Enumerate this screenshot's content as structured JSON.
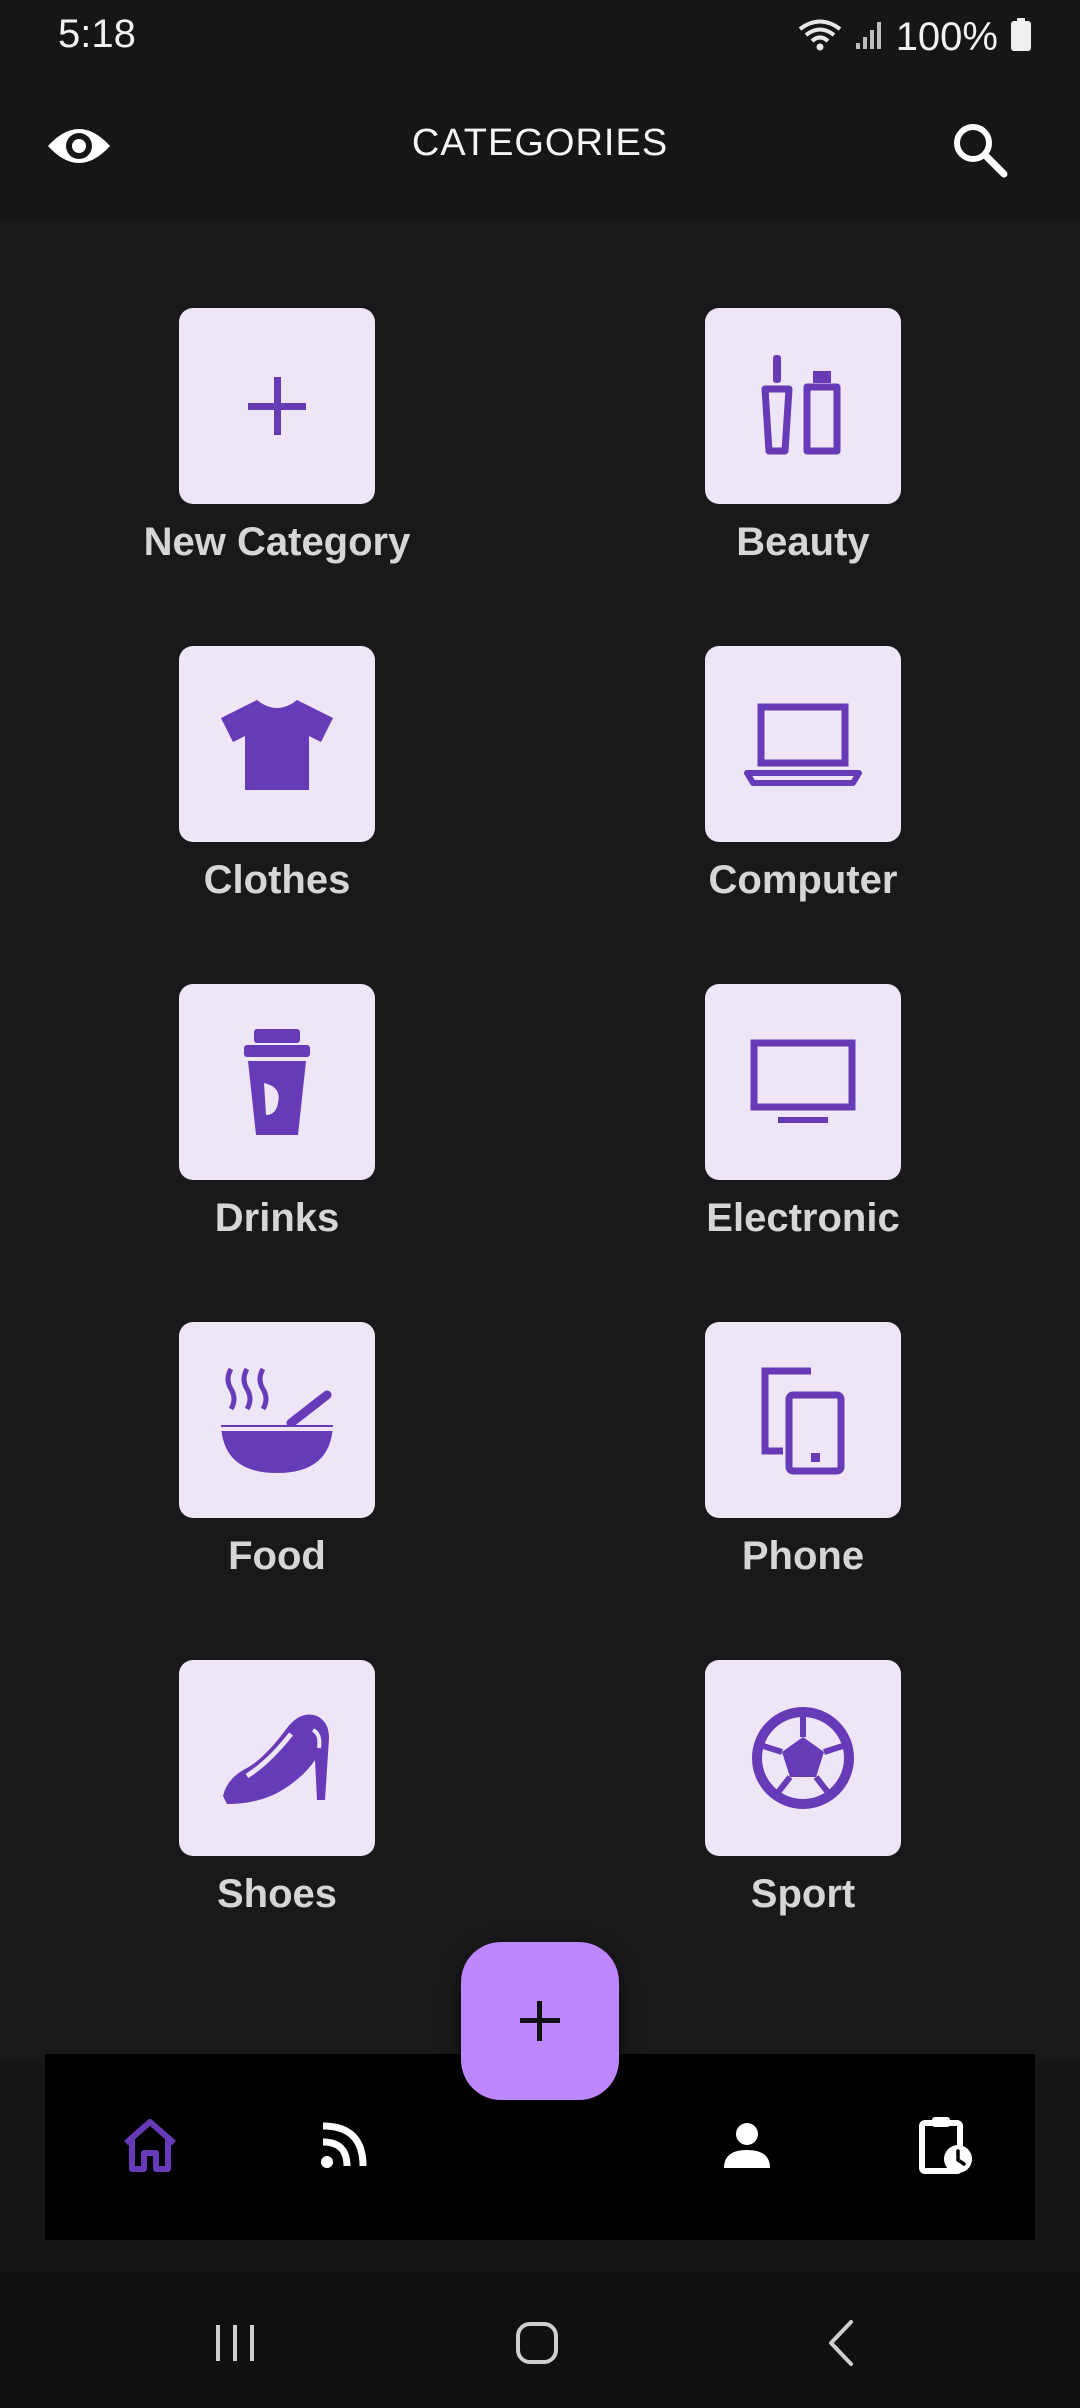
{
  "status_bar": {
    "time": "5:18",
    "battery_percent": "100%",
    "icons": [
      "wifi-icon",
      "signal-icon",
      "battery-icon"
    ]
  },
  "app_bar": {
    "title": "CATEGORIES",
    "left_icon": "eye-icon",
    "right_icon": "search-icon"
  },
  "categories": [
    {
      "label": "New Category",
      "icon": "plus-icon"
    },
    {
      "label": "Beauty",
      "icon": "beauty-icon"
    },
    {
      "label": "Clothes",
      "icon": "tshirt-icon"
    },
    {
      "label": "Computer",
      "icon": "laptop-icon"
    },
    {
      "label": "Drinks",
      "icon": "cup-icon"
    },
    {
      "label": "Electronic",
      "icon": "monitor-icon"
    },
    {
      "label": "Food",
      "icon": "bowl-icon"
    },
    {
      "label": "Phone",
      "icon": "devices-icon"
    },
    {
      "label": "Shoes",
      "icon": "heel-icon"
    },
    {
      "label": "Sport",
      "icon": "soccer-ball-icon"
    }
  ],
  "fab": {
    "icon": "plus-icon"
  },
  "bottom_nav": {
    "items": [
      {
        "name": "home",
        "icon": "home-icon",
        "active": true
      },
      {
        "name": "feed",
        "icon": "rss-icon",
        "active": false
      },
      {
        "name": "profile",
        "icon": "person-icon",
        "active": false
      },
      {
        "name": "history",
        "icon": "clipboard-clock-icon",
        "active": false
      }
    ]
  },
  "system_nav": [
    "recents-icon",
    "home-circle-icon",
    "back-icon"
  ],
  "colors": {
    "accent": "#673ab7",
    "tile_background": "#eee6f6",
    "fab": "#bd86fb",
    "background": "#19191b",
    "nav_background": "#000000",
    "label": "#d6d6d6"
  }
}
